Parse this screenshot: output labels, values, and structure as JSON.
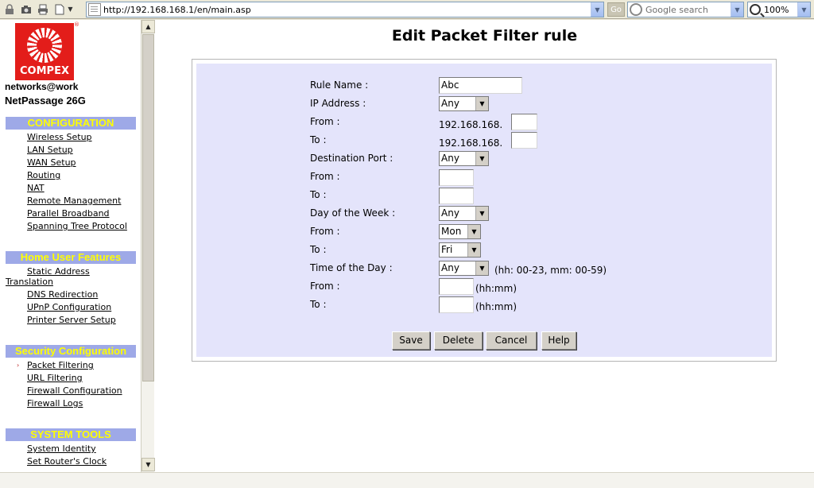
{
  "browser": {
    "url": "http://192.168.168.1/en/main.asp",
    "go_label": "Go",
    "search_placeholder": "Google search",
    "zoom": "100%"
  },
  "brand": {
    "logo_text": "COMPEX",
    "reg_mark": "®",
    "tagline": "networks@work",
    "product": "NetPassage 26G"
  },
  "sidebar": {
    "configuration": {
      "header": "CONFIGURATION",
      "items": [
        "Wireless Setup",
        "LAN Setup",
        "WAN Setup",
        "Routing",
        "NAT",
        "Remote Management",
        "Parallel Broadband",
        "Spanning Tree Protocol"
      ]
    },
    "home_user": {
      "header": "Home User Features",
      "static_address_1": "Static Address",
      "static_address_2": "Translation",
      "items": [
        "DNS Redirection",
        "UPnP Configuration",
        "Printer Server Setup"
      ]
    },
    "security": {
      "header": "Security Configuration",
      "bullet": "›",
      "items": [
        "Packet Filtering",
        "URL Filtering",
        "Firewall Configuration",
        "Firewall Logs"
      ]
    },
    "system_tools": {
      "header": "SYSTEM TOOLS",
      "items": [
        "System Identity",
        "Set Router's Clock"
      ]
    }
  },
  "form": {
    "title": "Edit Packet Filter rule",
    "rule_name_label": "Rule Name :",
    "rule_name_value": "Abc",
    "ip_address_label": "IP Address :",
    "ip_address_value": "Any",
    "ip_from_label": "From :",
    "ip_from_prefix": "192.168.168.",
    "ip_to_label": "To :",
    "ip_to_prefix": "192.168.168.",
    "dest_port_label": "Destination Port :",
    "dest_port_value": "Any",
    "port_from_label": "From :",
    "port_to_label": "To :",
    "day_label": "Day of the Week :",
    "day_value": "Any",
    "day_from_label": "From :",
    "day_from_value": "Mon",
    "day_to_label": "To :",
    "day_to_value": "Fri",
    "time_label": "Time of the Day :",
    "time_value": "Any",
    "time_hint": "(hh: 00-23, mm: 00-59)",
    "time_from_label": "From :",
    "time_to_label": "To :",
    "hhmm": "(hh:mm)"
  },
  "buttons": {
    "save": "Save",
    "delete": "Delete",
    "cancel": "Cancel",
    "help": "Help"
  }
}
